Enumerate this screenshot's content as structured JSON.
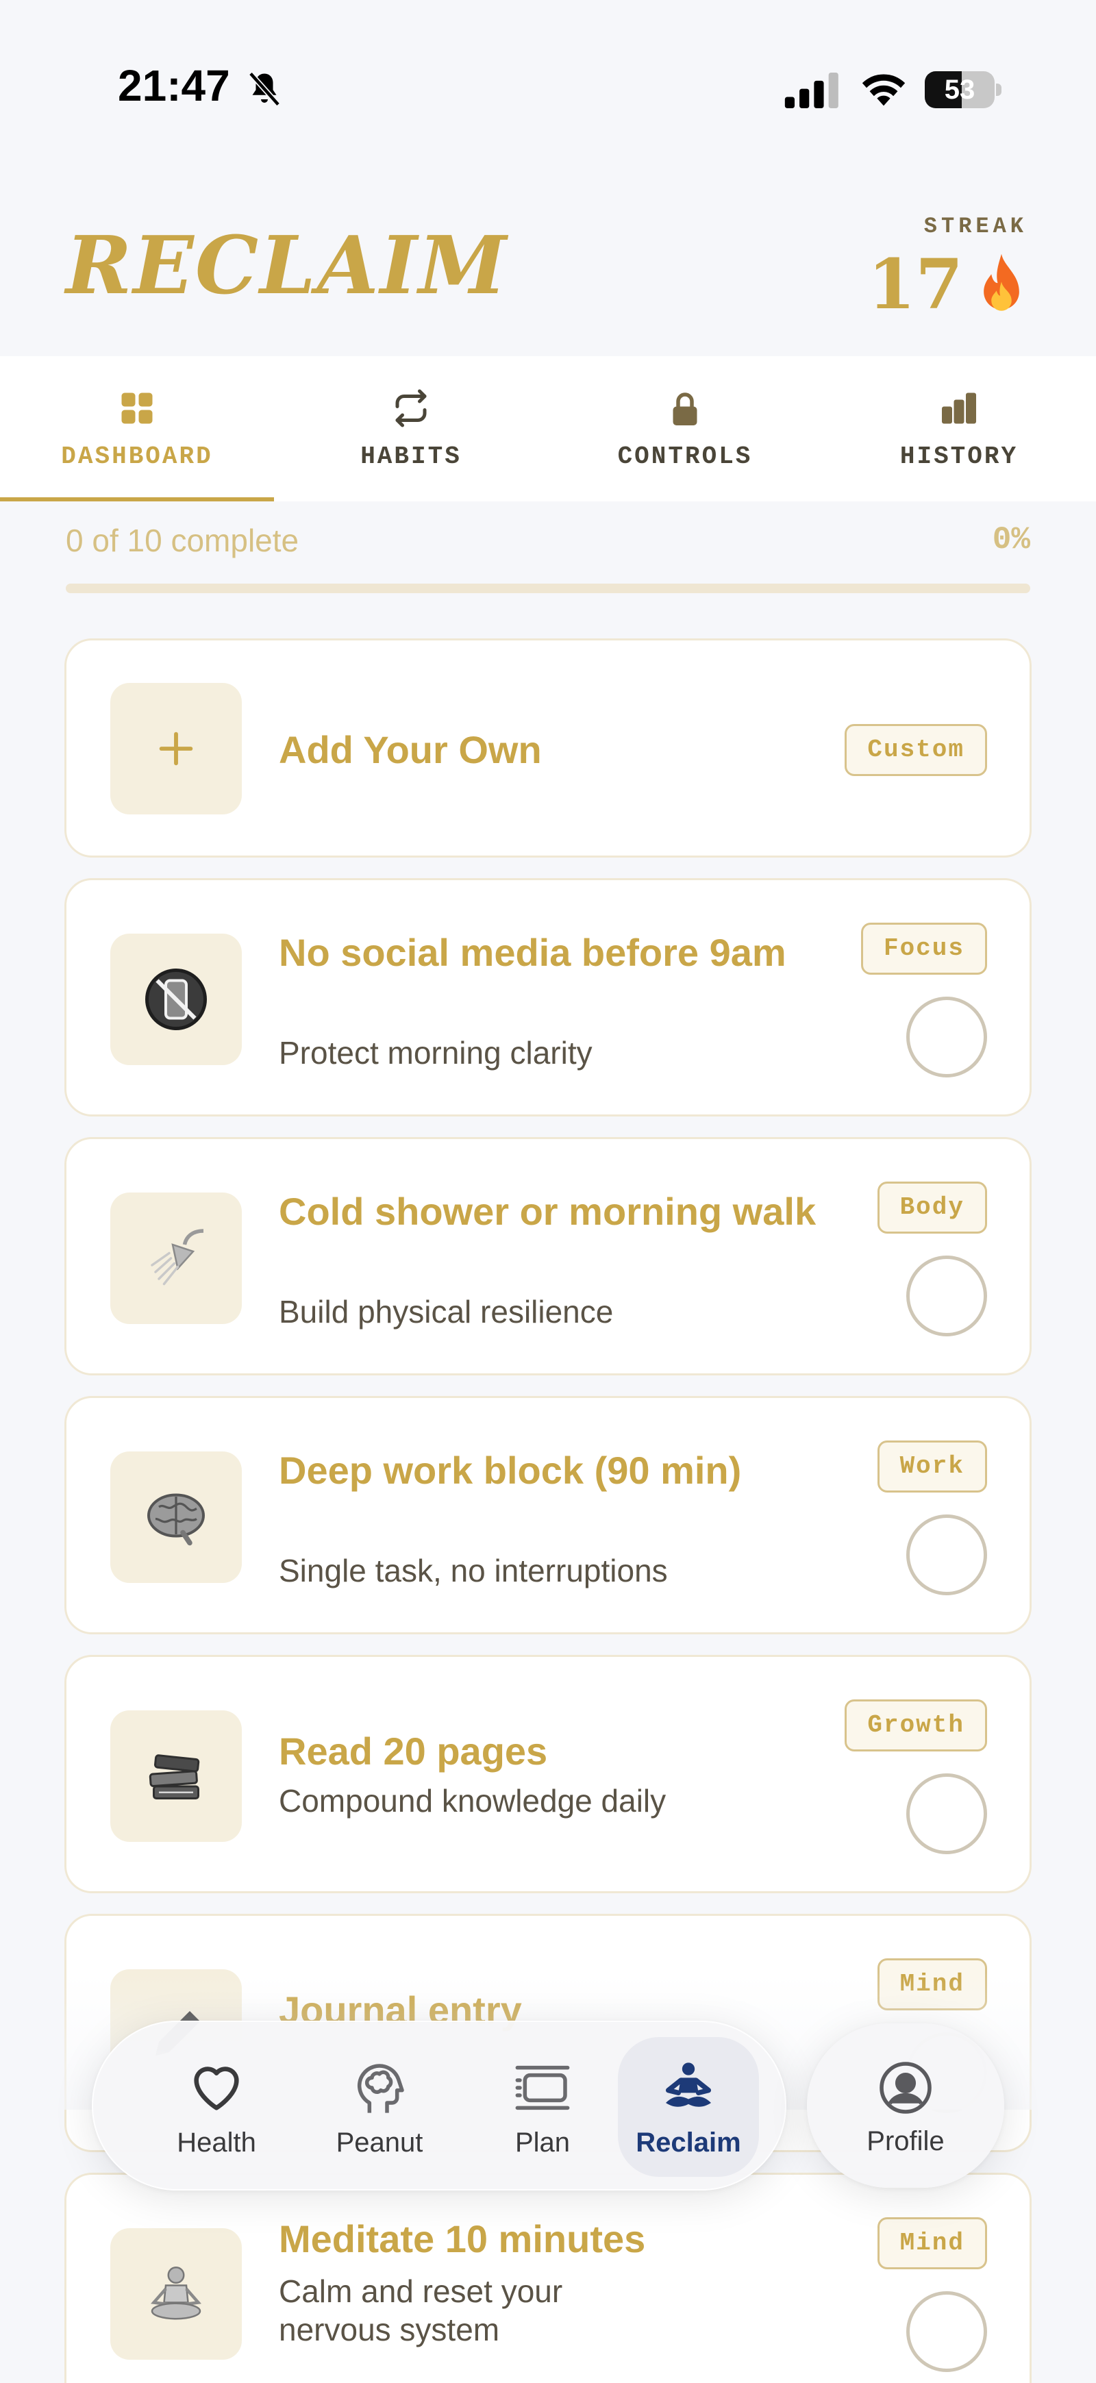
{
  "status_bar": {
    "time": "21:47",
    "battery": "53",
    "battery_level": 0.53,
    "icons": [
      "bell-slash-icon",
      "cellular-signal-icon",
      "wifi-icon",
      "battery-icon"
    ]
  },
  "header": {
    "title": "RECLAIM",
    "streak_label": "STREAK",
    "streak_value": "17",
    "streak_icon": "flame-icon"
  },
  "tabs": [
    {
      "label": "DASHBOARD",
      "icon": "grid-icon",
      "active": true
    },
    {
      "label": "HABITS",
      "icon": "repeat-icon",
      "active": false
    },
    {
      "label": "CONTROLS",
      "icon": "lock-icon",
      "active": false
    },
    {
      "label": "HISTORY",
      "icon": "bar-chart-icon",
      "active": false
    }
  ],
  "progress": {
    "text": "0 of 10 complete",
    "percent": "0%",
    "fraction": 0
  },
  "cards": [
    {
      "title": "Add Your Own",
      "subtitle": "",
      "badge": "Custom",
      "icon": "plus-icon"
    },
    {
      "title": "No social media before 9am",
      "subtitle": "Protect morning clarity",
      "badge": "Focus",
      "icon": "no-phone-icon"
    },
    {
      "title": "Cold shower or morning walk",
      "subtitle": "Build physical resilience",
      "badge": "Body",
      "icon": "shower-icon"
    },
    {
      "title": "Deep work block (90 min)",
      "subtitle": "Single task, no interruptions",
      "badge": "Work",
      "icon": "brain-icon"
    },
    {
      "title": "Read 20 pages",
      "subtitle": "Compound knowledge daily",
      "badge": "Growth",
      "icon": "books-icon"
    },
    {
      "title": "Journal entry",
      "subtitle": "",
      "badge": "Mind",
      "icon": "pencil-icon"
    },
    {
      "title": "Meditate 10 minutes",
      "subtitle": "Calm and reset your nervous system",
      "badge": "Mind",
      "icon": "meditation-icon"
    }
  ],
  "bottom_nav": [
    {
      "label": "Health",
      "icon": "heart-icon",
      "active": false
    },
    {
      "label": "Peanut",
      "icon": "head-brain-icon",
      "active": false
    },
    {
      "label": "Plan",
      "icon": "plan-icon",
      "active": false
    },
    {
      "label": "Reclaim",
      "icon": "meditation-figure-icon",
      "active": true
    }
  ],
  "profile": {
    "label": "Profile",
    "icon": "person-circle-icon"
  },
  "colors": {
    "accent_gold": "#c9a648",
    "nav_active": "#1d3a78",
    "background": "#f6f7fa"
  }
}
